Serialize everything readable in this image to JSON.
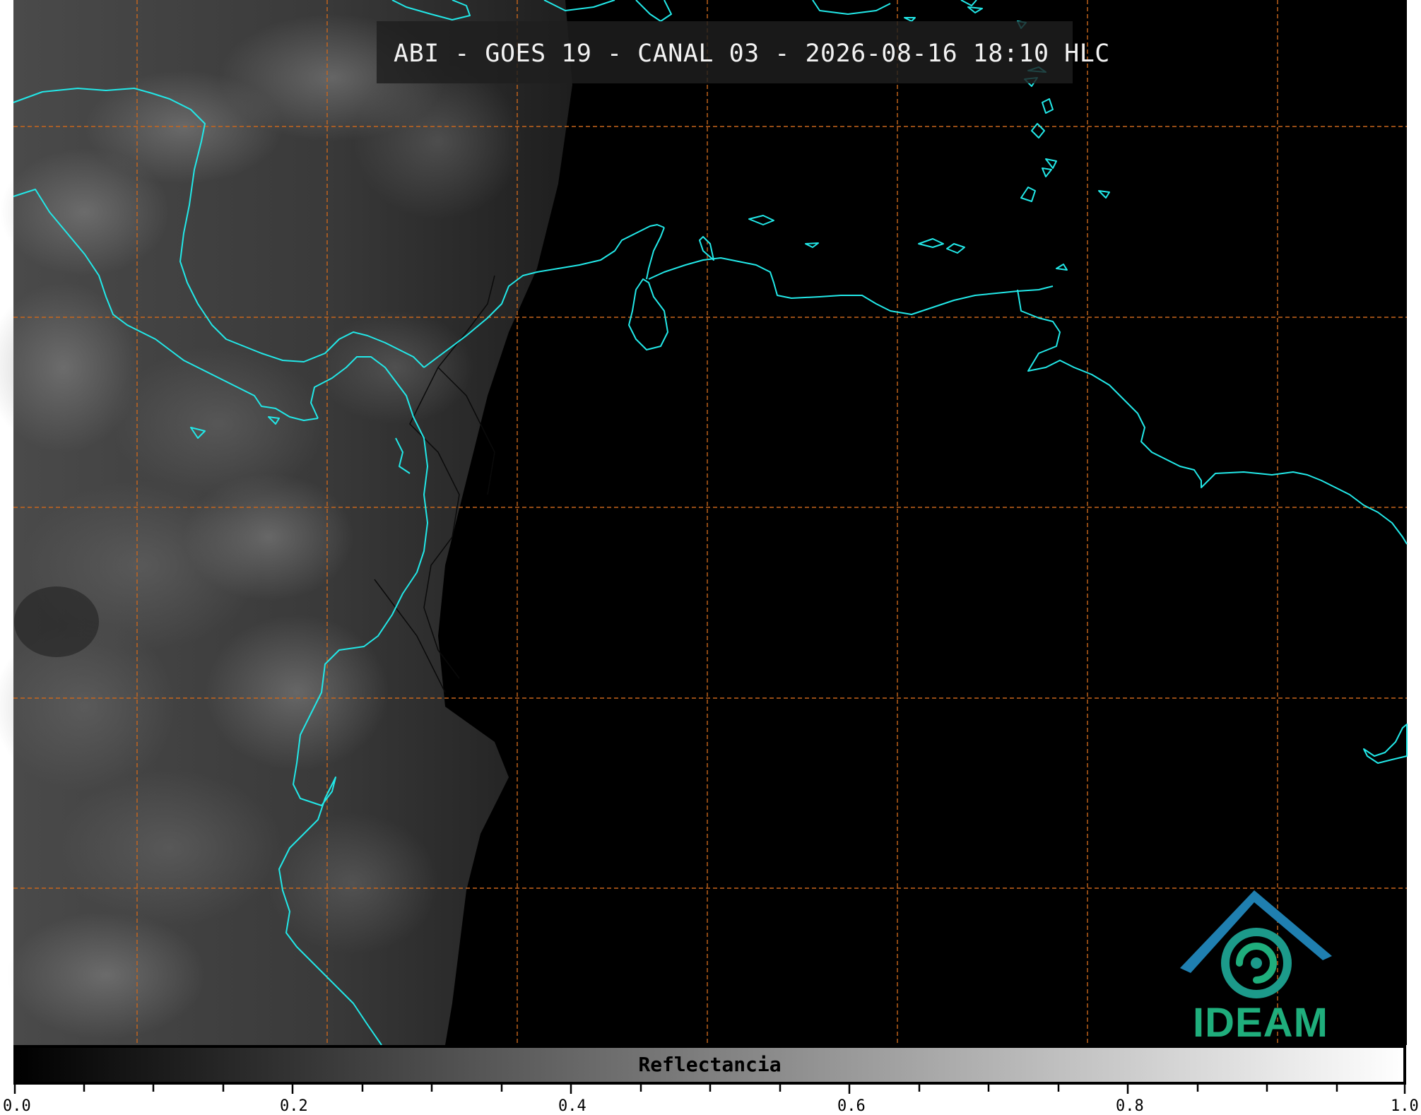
{
  "title": "ABI - GOES 19 - CANAL 03 - 2026-08-16 18:10 HLC",
  "colorbar": {
    "label": "Reflectancia",
    "ticks": [
      "0.0",
      "0.2",
      "0.4",
      "0.6",
      "0.8",
      "1.0"
    ],
    "range": [
      0.0,
      1.0
    ],
    "colormap": "grayscale black-to-white"
  },
  "logo": {
    "text": "IDEAM"
  },
  "colors": {
    "coastline": "#22e8e8",
    "gridlines": "#c8661c",
    "borders": "#0a0a0a",
    "logo_blue": "#1f6fb6",
    "logo_green": "#1fae7c"
  },
  "map": {
    "grid": "dashed",
    "night_side": "east"
  }
}
